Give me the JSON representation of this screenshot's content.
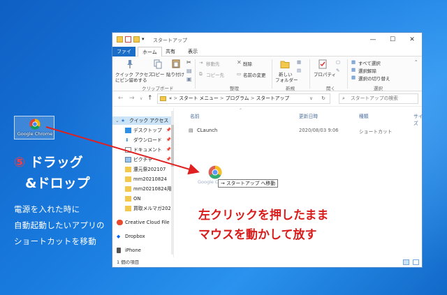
{
  "desktop": {
    "shortcut_label": "Google Chrome",
    "step_number": "⑤",
    "step_title_1": "ドラッグ",
    "step_title_2": "&ドロップ",
    "notes": [
      "電源を入れた時に",
      "自動起動したいアプリの",
      "ショートカットを移動"
    ]
  },
  "window": {
    "title": "スタートアップ",
    "controls": {
      "minimize": "—",
      "maximize": "☐",
      "close": "✕"
    },
    "tabs": {
      "file": "ファイル",
      "home": "ホーム",
      "share": "共有",
      "view": "表示"
    },
    "ribbon": {
      "quick_access_1": "クイック アクセス",
      "quick_access_2": "にピン留めする",
      "copy": "コピー",
      "paste": "貼り付け",
      "group_clipboard": "クリップボード",
      "move_to": "移動先",
      "copy_to": "コピー先",
      "delete": "削除",
      "rename": "名前の変更",
      "group_organize": "整理",
      "new_folder_1": "新しい",
      "new_folder_2": "フォルダー",
      "group_new": "新規",
      "properties": "プロパティ",
      "group_open": "開く",
      "select_all": "すべて選択",
      "select_none": "選択解除",
      "invert_selection": "選択の切り替え",
      "group_select": "選択"
    },
    "address": {
      "path": [
        "«",
        "スタート メニュー",
        "プログラム",
        "スタートアップ"
      ],
      "search_placeholder": "スタートアップの検索"
    },
    "sidebar": {
      "quick_access": "クイック アクセス",
      "items": [
        {
          "label": "デスクトップ",
          "pinned": true
        },
        {
          "label": "ダウンロード",
          "pinned": true
        },
        {
          "label": "ドキュメント",
          "pinned": true
        },
        {
          "label": "ピクチャ",
          "pinned": true
        },
        {
          "label": "還元祭202107",
          "pinned": false
        },
        {
          "label": "mm20210824",
          "pinned": false
        },
        {
          "label": "mm20210824用",
          "pinned": false
        },
        {
          "label": "ON",
          "pinned": false
        },
        {
          "label": "買取メルマガ20210",
          "pinned": false
        },
        {
          "label": "Creative Cloud File",
          "pinned": false
        },
        {
          "label": "Dropbox",
          "pinned": false
        },
        {
          "label": "iPhone",
          "pinned": false
        }
      ]
    },
    "columns": {
      "name": "名前",
      "date": "更新日時",
      "type": "種類",
      "size": "サイズ"
    },
    "files": [
      {
        "name": "CLaunch",
        "date": "2020/08/03 9:06",
        "type": "ショートカット"
      }
    ],
    "status": "1 個の項目"
  },
  "drag": {
    "ghost_label": "Google C",
    "tooltip": "→ スタートアップ へ移動"
  },
  "annotation": {
    "line1": "左クリックを押したまま",
    "line2": "マウスを動かして放す",
    "color": "#d81b1b"
  }
}
